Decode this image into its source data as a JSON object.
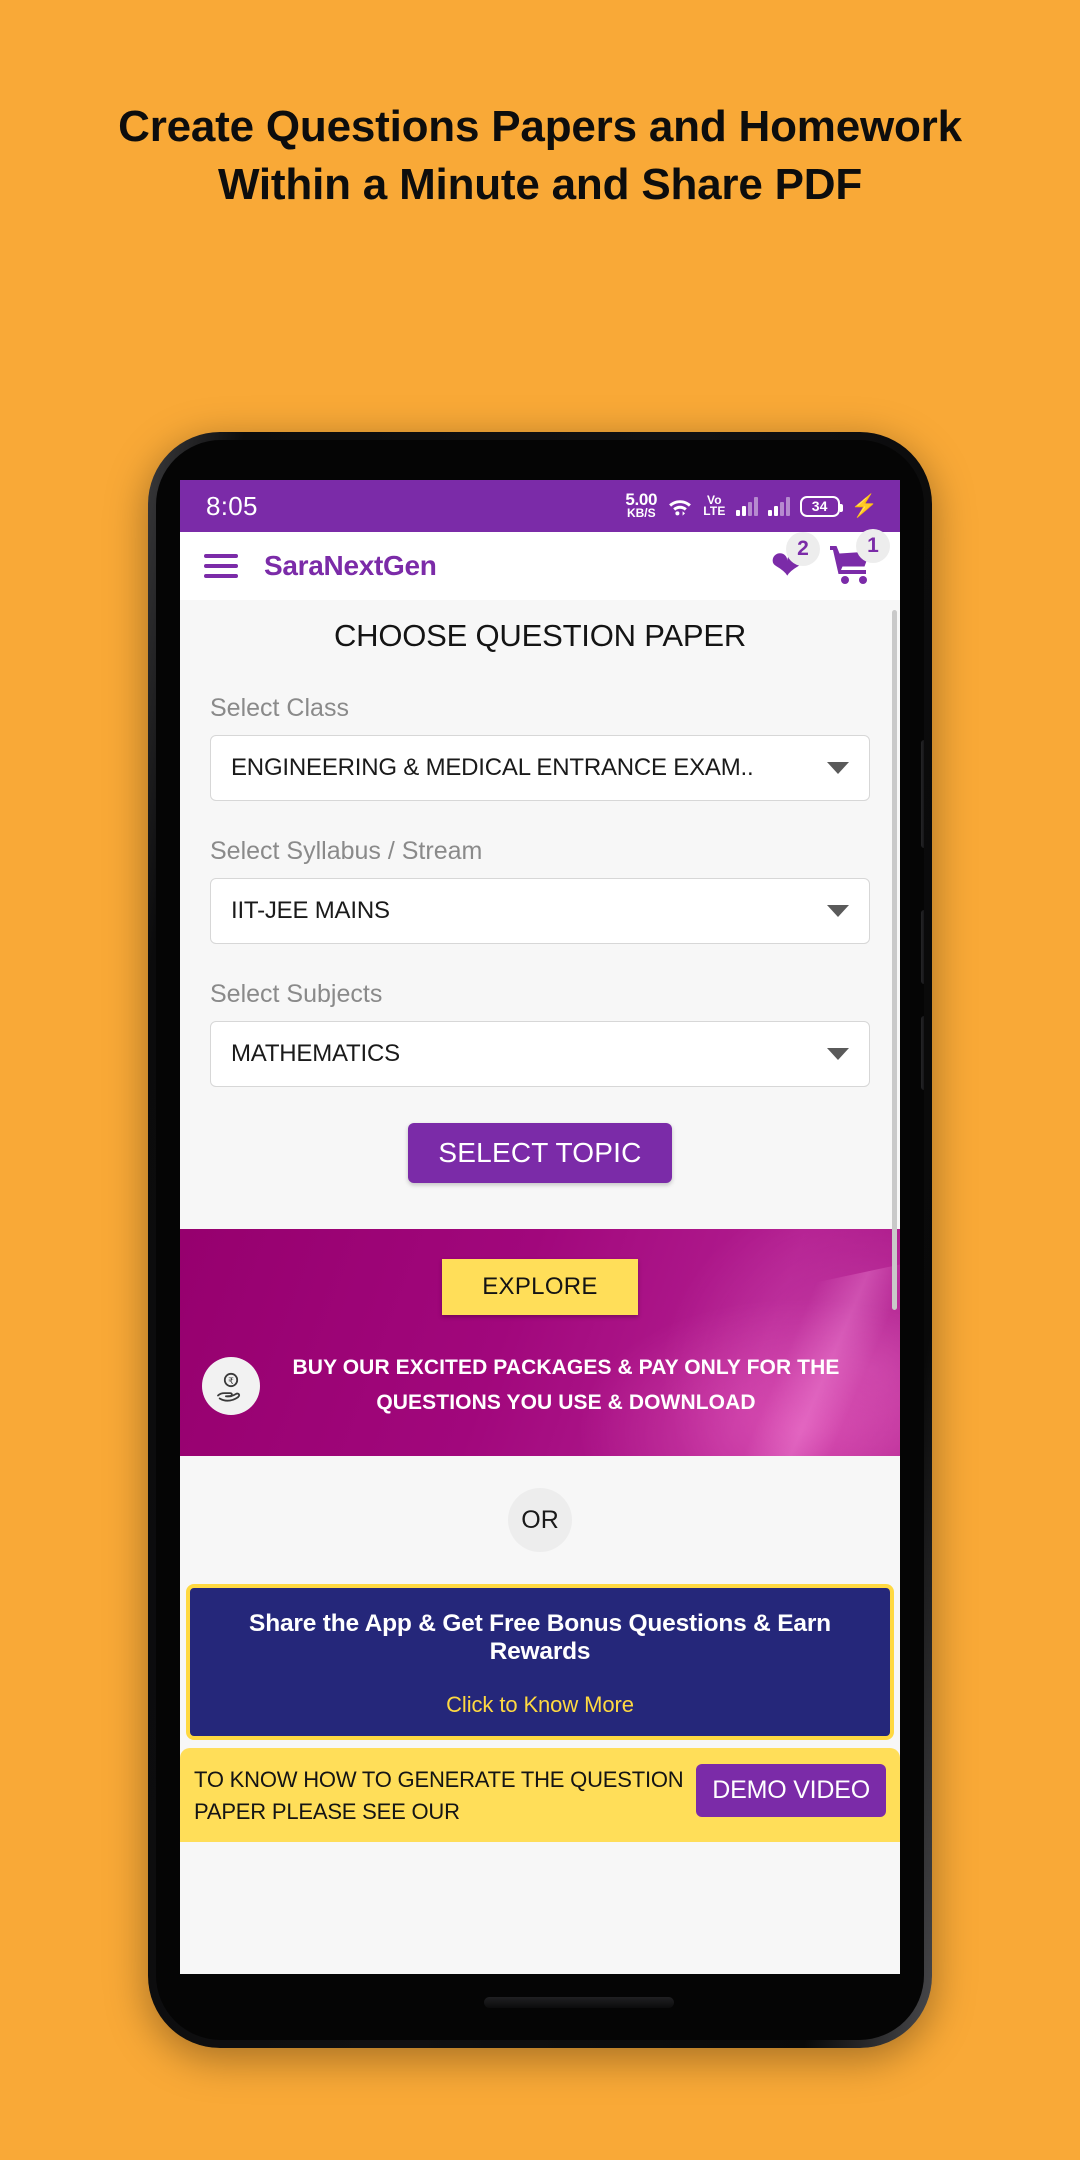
{
  "promo_headline": "Create Questions Papers and Homework Within a Minute and Share PDF",
  "status_bar": {
    "time": "8:05",
    "net_speed_value": "5.00",
    "net_speed_unit": "KB/S",
    "wifi_icon": "wifi-icon",
    "volte_line1": "Vo",
    "volte_line2": "LTE",
    "battery_level": "34",
    "charging_icon": "charging-bolt-icon"
  },
  "app_bar": {
    "menu_icon": "hamburger-menu-icon",
    "brand": "SaraNextGen",
    "wishlist_icon": "heart-icon",
    "wishlist_count": "2",
    "cart_icon": "cart-icon",
    "cart_count": "1"
  },
  "form": {
    "title": "CHOOSE QUESTION PAPER",
    "fields": [
      {
        "label": "Select Class",
        "value": "ENGINEERING & MEDICAL ENTRANCE EXAM.."
      },
      {
        "label": "Select Syllabus / Stream",
        "value": "IIT-JEE MAINS"
      },
      {
        "label": "Select Subjects",
        "value": "MATHEMATICS"
      }
    ],
    "submit_label": "SELECT TOPIC"
  },
  "promo_banner": {
    "explore_label": "EXPLORE",
    "icon": "rupee-in-hand-icon",
    "text": "BUY OUR EXCITED PACKAGES & PAY ONLY FOR THE QUESTIONS YOU USE & DOWNLOAD",
    "background_color": "#A1077C",
    "explore_color": "#FFDE59"
  },
  "divider": {
    "label": "OR"
  },
  "share_banner": {
    "title": "Share the App & Get Free Bonus Questions & Earn Rewards",
    "subtitle": "Click to Know More",
    "background_color": "#25277A",
    "border_color": "#FFD941",
    "subtitle_color": "#FFD941"
  },
  "bottom_bar": {
    "text": "TO KNOW HOW TO GENERATE THE QUESTION PAPER PLEASE SEE OUR",
    "button_label": "DEMO VIDEO",
    "background_color": "#FFDE59",
    "button_color": "#7B2BA8"
  }
}
